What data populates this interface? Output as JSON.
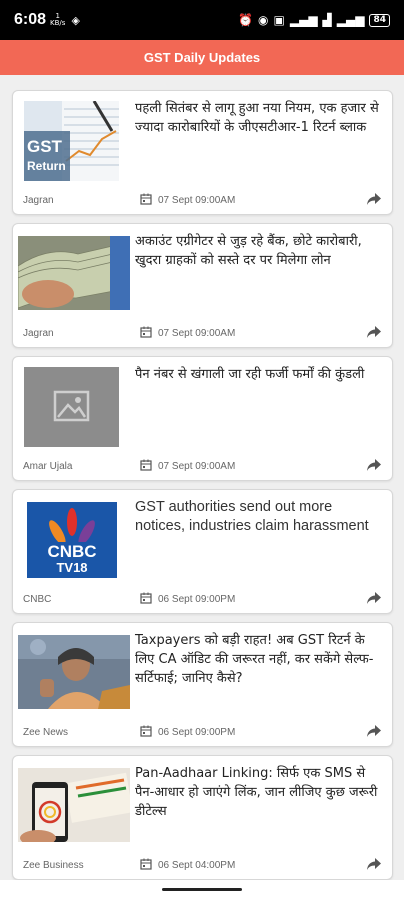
{
  "status_bar": {
    "time": "6:08",
    "net_speed": "1",
    "net_unit": "KB/s",
    "battery": "84"
  },
  "app": {
    "title": "GST Daily Updates"
  },
  "thumb_labels": {
    "gst_top": "GST",
    "gst_bottom": "Return",
    "cnbc_top": "CNBC",
    "cnbc_bottom": "TV18"
  },
  "articles": [
    {
      "title": "पहली सितंबर से लागू हुआ नया नियम, एक हजार से ज्यादा कारोबारियों के जीएसटीआर-1 रिटर्न ब्लाक",
      "source": "Jagran",
      "date": "07 Sept 09:00AM",
      "thumb": "gst-return"
    },
    {
      "title": "अकाउंट एग्रीगेटर से जुड़ रहे बैंक, छोटे कारोबारी, खुदरा ग्राहकों को सस्ते दर पर मिलेगा लोन",
      "source": "Jagran",
      "date": "07 Sept 09:00AM",
      "thumb": "currency"
    },
    {
      "title": "पैन नंबर से खंगाली जा रही फर्जी फर्मों की कुंडली",
      "source": "Amar Ujala",
      "date": "07 Sept 09:00AM",
      "thumb": "placeholder"
    },
    {
      "title": "GST authorities send out more notices, industries claim harassment",
      "source": "CNBC",
      "date": "06 Sept 09:00PM",
      "thumb": "cnbc"
    },
    {
      "title": "Taxpayers को बड़ी राहत! अब GST रिटर्न के लिए CA ऑडिट की जरूरत नहीं, कर सकेंगे सेल्फ-सर्टिफाई; जानिए कैसे?",
      "source": "Zee News",
      "date": "06 Sept 09:00PM",
      "thumb": "minister"
    },
    {
      "title": "Pan-Aadhaar Linking: सिर्फ एक SMS से पैन-आधार हो जाएंगे लिंक, जान लीजिए कुछ जरूरी डीटेल्स",
      "source": "Zee Business",
      "date": "06 Sept 04:00PM",
      "thumb": "aadhaar"
    }
  ],
  "colors": {
    "accent": "#f26855",
    "status_bar": "#000000",
    "card_bg": "#ffffff",
    "page_bg": "#efefef"
  }
}
